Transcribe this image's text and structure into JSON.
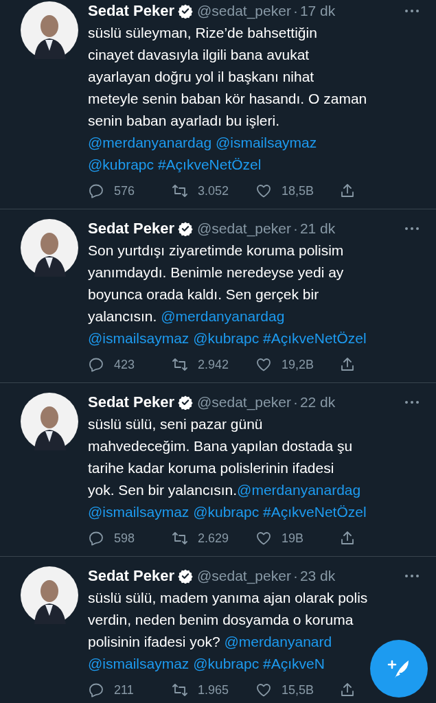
{
  "tweets": [
    {
      "author": {
        "name": "Sedat Peker",
        "verified": true,
        "handle": "@sedat_peker"
      },
      "separator": "·",
      "time": "17 dk",
      "body": [
        [
          {
            "kind": "text",
            "text": "süslü süleyman, Rize’de bahsettiğin"
          }
        ],
        [
          {
            "kind": "text",
            "text": "cinayet davasıyla ilgili bana avukat"
          }
        ],
        [
          {
            "kind": "text",
            "text": "ayarlayan doğru yol il başkanı nihat"
          }
        ],
        [
          {
            "kind": "text",
            "text": "meteyle senin baban kör hasandı. O zaman"
          }
        ],
        [
          {
            "kind": "text",
            "text": "senin baban ayarladı bu işleri."
          }
        ],
        [
          {
            "kind": "mention",
            "text": "@merdanyanardag"
          },
          {
            "kind": "mention",
            "text": "@ismailsaymaz"
          }
        ],
        [
          {
            "kind": "mention",
            "text": "@kubrapc"
          },
          {
            "kind": "hashtag",
            "text": "#AçıkveNetÖzel"
          }
        ]
      ],
      "replies": "576",
      "retweets": "3.052",
      "likes": "18,5B"
    },
    {
      "author": {
        "name": "Sedat Peker",
        "verified": true,
        "handle": "@sedat_peker"
      },
      "separator": "·",
      "time": "21 dk",
      "body": [
        [
          {
            "kind": "text",
            "text": "Son yurtdışı ziyaretimde koruma polisim"
          }
        ],
        [
          {
            "kind": "text",
            "text": "yanımdaydı. Benimle neredeyse yedi ay"
          }
        ],
        [
          {
            "kind": "text",
            "text": "boyunca orada kaldı. Sen gerçek bir"
          }
        ],
        [
          {
            "kind": "text",
            "text": "yalancısın. "
          },
          {
            "kind": "mention",
            "text": "@merdanyanardag"
          }
        ],
        [
          {
            "kind": "mention",
            "text": "@ismailsaymaz"
          },
          {
            "kind": "mention",
            "text": "@kubrapc"
          },
          {
            "kind": "hashtag",
            "text": "#AçıkveNetÖzel"
          }
        ]
      ],
      "replies": "423",
      "retweets": "2.942",
      "likes": "19,2B"
    },
    {
      "author": {
        "name": "Sedat Peker",
        "verified": true,
        "handle": "@sedat_peker"
      },
      "separator": "·",
      "time": "22 dk",
      "body": [
        [
          {
            "kind": "text",
            "text": "süslü sülü, seni pazar günü"
          }
        ],
        [
          {
            "kind": "text",
            "text": "mahvedeceğim. Bana yapılan dostada şu"
          }
        ],
        [
          {
            "kind": "text",
            "text": "tarihe kadar koruma polislerinin ifadesi"
          }
        ],
        [
          {
            "kind": "text",
            "text": "yok. Sen bir yalancısın."
          },
          {
            "kind": "mention",
            "text": "@merdanyanardag"
          }
        ],
        [
          {
            "kind": "mention",
            "text": "@ismailsaymaz"
          },
          {
            "kind": "mention",
            "text": "@kubrapc"
          },
          {
            "kind": "hashtag",
            "text": "#AçıkveNetÖzel"
          }
        ]
      ],
      "replies": "598",
      "retweets": "2.629",
      "likes": "19B"
    },
    {
      "author": {
        "name": "Sedat Peker",
        "verified": true,
        "handle": "@sedat_peker"
      },
      "separator": "·",
      "time": "23 dk",
      "body": [
        [
          {
            "kind": "text",
            "text": "süslü sülü, madem yanıma ajan olarak polis"
          }
        ],
        [
          {
            "kind": "text",
            "text": "verdin, neden benim dosyamda o koruma"
          }
        ],
        [
          {
            "kind": "text",
            "text": "polisinin ifadesi yok? "
          },
          {
            "kind": "mention",
            "text": "@merdanyanard"
          }
        ],
        [
          {
            "kind": "mention",
            "text": "@ismailsaymaz"
          },
          {
            "kind": "mention",
            "text": "@kubrapc"
          },
          {
            "kind": "hashtag",
            "text": "#AçıkveN"
          }
        ]
      ],
      "replies": "211",
      "retweets": "1.965",
      "likes": "15,5B"
    }
  ]
}
